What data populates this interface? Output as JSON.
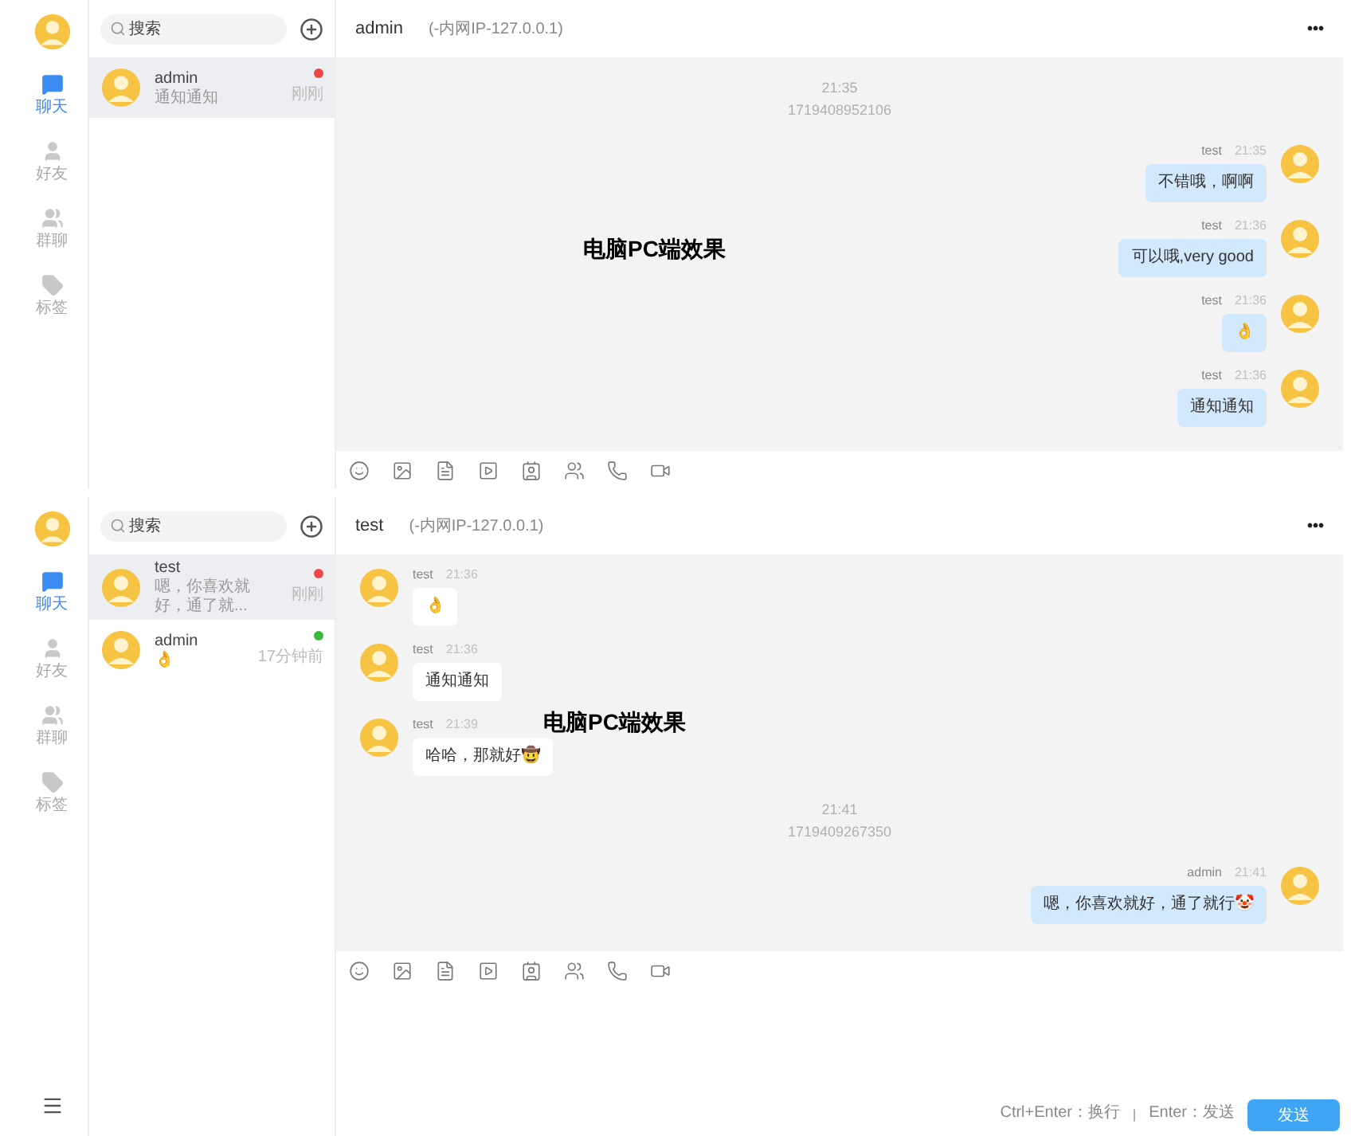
{
  "panels": [
    {
      "nav": [
        {
          "label": "聊天",
          "selected": true
        },
        {
          "label": "好友",
          "selected": false
        },
        {
          "label": "群聊",
          "selected": false
        },
        {
          "label": "标签",
          "selected": false
        }
      ],
      "search": {
        "placeholder": "搜索"
      },
      "conversations": [
        {
          "name": "admin",
          "preview": "通知通知",
          "time": "刚刚",
          "color": "#f04848",
          "selected": true
        }
      ],
      "header": {
        "name": "admin",
        "ip": "(-内网IP-127.0.0.1)",
        "menu": "•••"
      },
      "messages": [
        {
          "kind": "time",
          "time": "21:35",
          "stamp": "1719408952106"
        },
        {
          "kind": "sent",
          "sender": "test",
          "time": "21:35",
          "text": "不错哦，啊啊"
        },
        {
          "kind": "sent",
          "sender": "test",
          "time": "21:36",
          "text": "可以哦,very good"
        },
        {
          "kind": "sent",
          "sender": "test",
          "time": "21:36",
          "text": "👌"
        },
        {
          "kind": "sent",
          "sender": "test",
          "time": "21:36",
          "text": "通知通知"
        }
      ],
      "overlay_label": "电脑PC端效果"
    },
    {
      "nav": [
        {
          "label": "聊天",
          "selected": true
        },
        {
          "label": "好友",
          "selected": false
        },
        {
          "label": "群聊",
          "selected": false
        },
        {
          "label": "标签",
          "selected": false
        }
      ],
      "search": {
        "placeholder": "搜索"
      },
      "conversations": [
        {
          "name": "test",
          "preview": "嗯，你喜欢就好，通了就...",
          "time": "刚刚",
          "color": "#f04848",
          "selected": true
        },
        {
          "name": "admin",
          "preview": "👌",
          "time": "17分钟前",
          "color": "#3cb93c",
          "selected": false
        }
      ],
      "header": {
        "name": "test",
        "ip": "(-内网IP-127.0.0.1)",
        "menu": "•••"
      },
      "messages": [
        {
          "kind": "received",
          "sender": "test",
          "time": "21:36",
          "text": "👌"
        },
        {
          "kind": "received",
          "sender": "test",
          "time": "21:36",
          "text": "通知通知"
        },
        {
          "kind": "received",
          "sender": "test",
          "time": "21:39",
          "text": "哈哈，那就好🤠"
        },
        {
          "kind": "time",
          "time": "21:41",
          "stamp": "1719409267350"
        },
        {
          "kind": "sent",
          "sender": "admin",
          "time": "21:41",
          "text": "嗯，你喜欢就好，通了就行🤡"
        }
      ],
      "overlay_label": "电脑PC端效果",
      "composer": {
        "hint": "Ctrl+Enter：换行",
        "separator": "|",
        "hint2": "Enter：发送",
        "send": "发送"
      }
    }
  ]
}
